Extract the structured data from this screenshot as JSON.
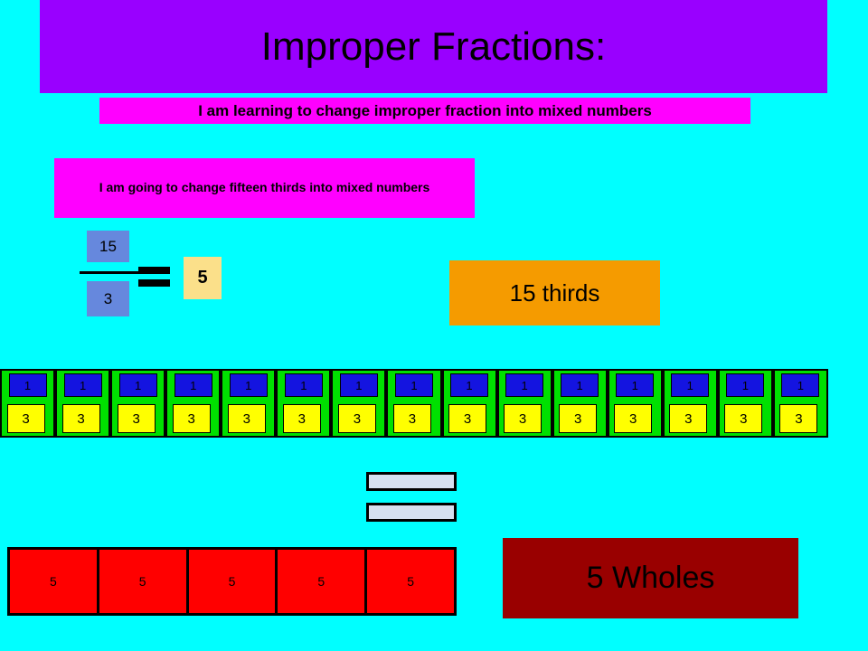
{
  "slide": {
    "background_color": "#00FFFF",
    "title": "Improper Fractions:",
    "title_box_color": "#9900FF"
  },
  "objective": {
    "text": "I am learning to change improper fraction into mixed numbers",
    "box_color": "#FF00FF"
  },
  "task": {
    "text": "I am going to change fifteen thirds into mixed numbers",
    "box_color": "#FF00FF"
  },
  "fraction": {
    "numerator": "15",
    "denominator": "3",
    "equals_symbol": "=",
    "quotient": "5",
    "numerator_box_color": "#6688DD",
    "denominator_box_color": "#6688DD",
    "quotient_box_color": "#FBE08A"
  },
  "orange_label": {
    "text": "15 thirds",
    "box_color": "#F59B00"
  },
  "fraction_strip": {
    "count": 15,
    "strip_color": "#00E000",
    "numerator_color": "#1414E0",
    "denominator_color": "#FFFF00",
    "cells": [
      {
        "numerator": "1",
        "denominator": "3"
      },
      {
        "numerator": "1",
        "denominator": "3"
      },
      {
        "numerator": "1",
        "denominator": "3"
      },
      {
        "numerator": "1",
        "denominator": "3"
      },
      {
        "numerator": "1",
        "denominator": "3"
      },
      {
        "numerator": "1",
        "denominator": "3"
      },
      {
        "numerator": "1",
        "denominator": "3"
      },
      {
        "numerator": "1",
        "denominator": "3"
      },
      {
        "numerator": "1",
        "denominator": "3"
      },
      {
        "numerator": "1",
        "denominator": "3"
      },
      {
        "numerator": "1",
        "denominator": "3"
      },
      {
        "numerator": "1",
        "denominator": "3"
      },
      {
        "numerator": "1",
        "denominator": "3"
      },
      {
        "numerator": "1",
        "denominator": "3"
      },
      {
        "numerator": "1",
        "denominator": "3"
      }
    ]
  },
  "big_equals": {
    "symbol": "=",
    "bar_color": "#D6E0F0"
  },
  "wholes_row": {
    "count": 5,
    "cell_color": "#FF0000",
    "cells": [
      {
        "value": "5"
      },
      {
        "value": "5"
      },
      {
        "value": "5"
      },
      {
        "value": "5"
      },
      {
        "value": "5"
      }
    ]
  },
  "result": {
    "text": "5 Wholes",
    "box_color": "#990000"
  }
}
